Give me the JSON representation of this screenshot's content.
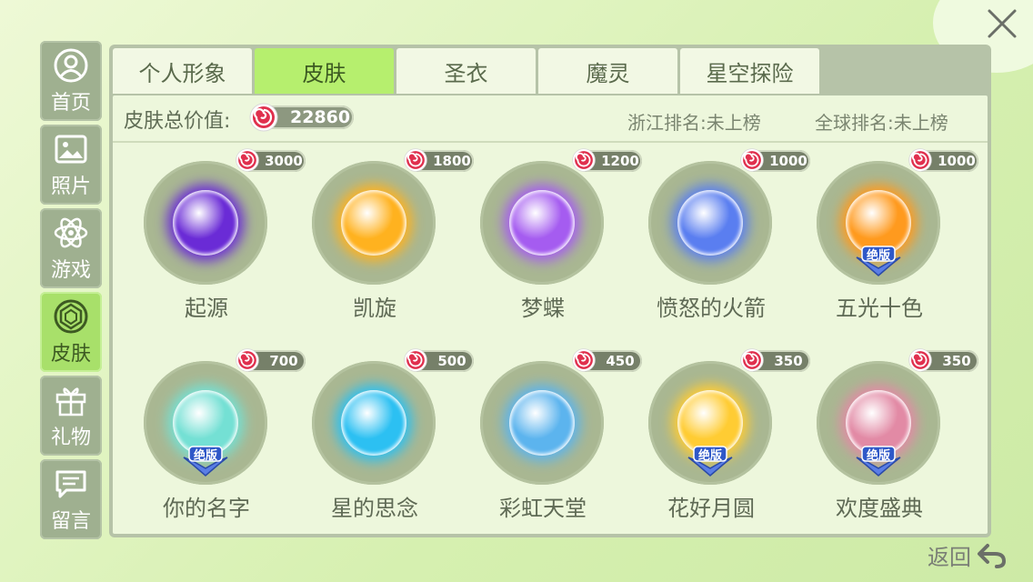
{
  "sidebar": {
    "items": [
      {
        "label": "首页",
        "icon": "user-icon"
      },
      {
        "label": "照片",
        "icon": "photo-icon"
      },
      {
        "label": "游戏",
        "icon": "atom-icon"
      },
      {
        "label": "皮肤",
        "icon": "skin-icon",
        "active": true
      },
      {
        "label": "礼物",
        "icon": "gift-icon"
      },
      {
        "label": "留言",
        "icon": "message-icon"
      }
    ]
  },
  "tabs": [
    {
      "label": "个人形象"
    },
    {
      "label": "皮肤",
      "active": true
    },
    {
      "label": "圣衣"
    },
    {
      "label": "魔灵"
    },
    {
      "label": "星空探险"
    }
  ],
  "summary": {
    "total_label": "皮肤总价值:",
    "total_value": "22860",
    "zhejiang_rank": "浙江排名:未上榜",
    "global_rank": "全球排名:未上榜"
  },
  "skins": [
    {
      "name": "起源",
      "price": "3000",
      "color": "#6a2bd6"
    },
    {
      "name": "凯旋",
      "price": "1800",
      "color": "#ffb21f"
    },
    {
      "name": "梦蝶",
      "price": "1200",
      "color": "#a55cf0"
    },
    {
      "name": "愤怒的火箭",
      "price": "1000",
      "color": "#5a7ef0"
    },
    {
      "name": "五光十色",
      "price": "1000",
      "color": "#ff9a1e",
      "badge": "绝版"
    },
    {
      "name": "你的名字",
      "price": "700",
      "color": "#74e0d4",
      "badge": "绝版"
    },
    {
      "name": "星的思念",
      "price": "500",
      "color": "#2cc0f2"
    },
    {
      "name": "彩虹天堂",
      "price": "450",
      "color": "#5cb4ee"
    },
    {
      "name": "花好月圆",
      "price": "350",
      "color": "#ffcc33",
      "badge": "绝版"
    },
    {
      "name": "欢度盛典",
      "price": "350",
      "color": "#e28aa5",
      "badge": "绝版"
    }
  ],
  "footer": {
    "back_label": "返回"
  },
  "colors": {
    "accent": "#b6ef6e",
    "panel": "#b6c3a8",
    "coin": "#e0304e"
  }
}
